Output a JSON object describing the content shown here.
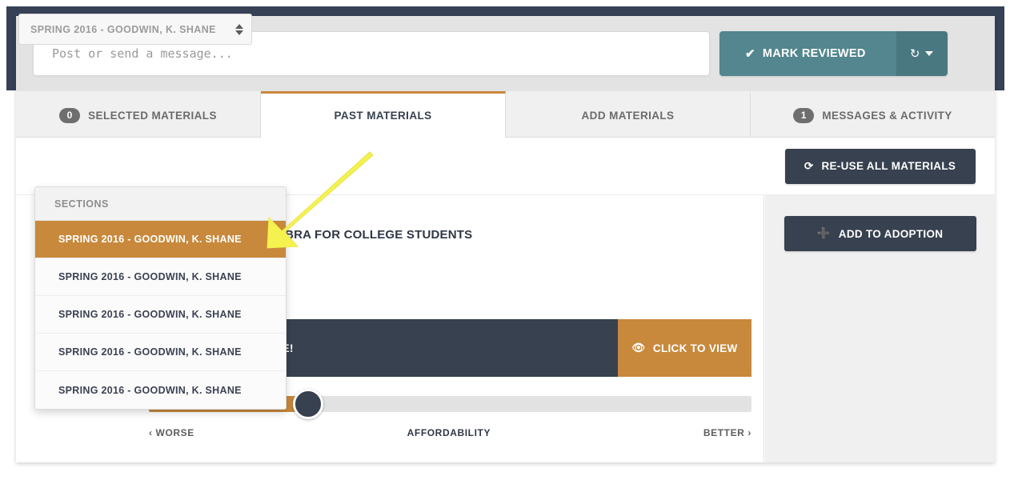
{
  "composer": {
    "placeholder": "Post or send a message...",
    "value": "",
    "mark_reviewed_label": "MARK REVIEWED",
    "check_icon": "check-icon",
    "history_icon": "undo-history-icon"
  },
  "tabs": [
    {
      "label": "SELECTED MATERIALS",
      "badge": "0",
      "active": false
    },
    {
      "label": "PAST MATERIALS",
      "badge": null,
      "active": true
    },
    {
      "label": "ADD MATERIALS",
      "badge": null,
      "active": false
    },
    {
      "label": "MESSAGES & ACTIVITY",
      "badge": "1",
      "active": false
    }
  ],
  "section_select": {
    "value": "SPRING 2016 - GOODWIN, K. SHANE",
    "group_label": "SECTIONS",
    "options": [
      "SPRING 2016 - GOODWIN, K. SHANE",
      "SPRING 2016 - GOODWIN, K. SHANE",
      "SPRING 2016 - GOODWIN, K. SHANE",
      "SPRING 2016 - GOODWIN, K. SHANE",
      "SPRING 2016 - GOODWIN, K. SHANE"
    ],
    "highlighted_index": 0
  },
  "material": {
    "title": "INTERMEDIATE ALGEBRA FOR COLLEGE STUDENTS",
    "promo_text": "OPTIONS AVAILABLE!",
    "promo_cta_label": "CLICK TO VIEW",
    "eye_icon": "eye-icon"
  },
  "meter": {
    "left_label": "‹  WORSE",
    "center_label": "AFFORDABILITY",
    "right_label": "BETTER  ›",
    "value_percent": 26
  },
  "right_panel": {
    "reuse_all_label": "RE-USE ALL MATERIALS",
    "reuse_icon": "refresh-icon",
    "add_adoption_label": "ADD TO ADOPTION",
    "add_icon": "plus-icon"
  },
  "colors": {
    "accent_orange": "#c8893c",
    "navy": "#37414f",
    "teal": "#53868f",
    "annotation_yellow": "#f5f24f"
  }
}
